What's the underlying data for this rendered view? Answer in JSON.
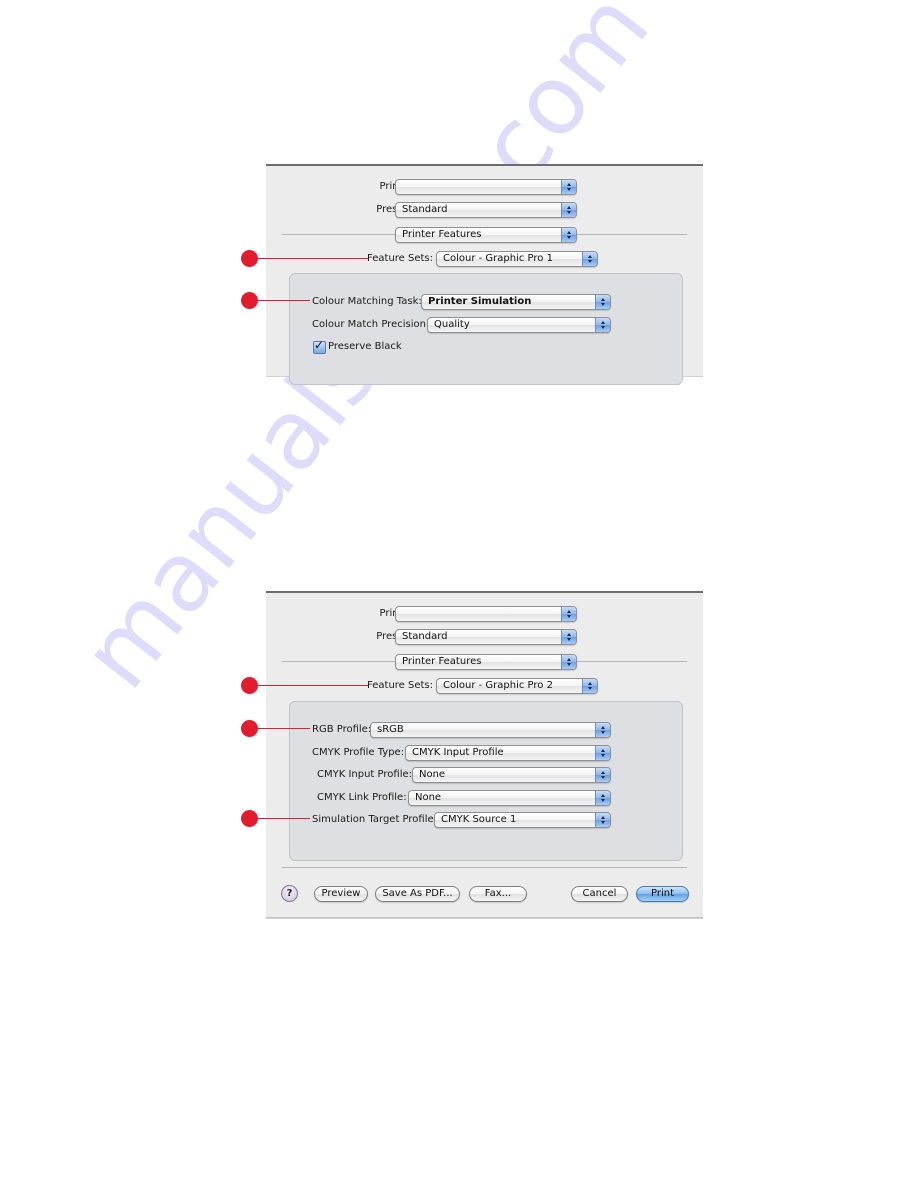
{
  "dialog1": {
    "printer": {
      "label": "Printer:",
      "value": ""
    },
    "presets": {
      "label": "Presets:",
      "value": "Standard"
    },
    "pane": {
      "value": "Printer Features"
    },
    "feature_sets": {
      "label": "Feature Sets:",
      "value": "Colour - Graphic Pro 1"
    },
    "colour_matching_task": {
      "label": "Colour Matching Task:",
      "value": "Printer Simulation"
    },
    "colour_match_precision": {
      "label": "Colour Match Precision:",
      "value": "Quality"
    },
    "preserve_black": {
      "label": "Preserve Black",
      "checked": true
    }
  },
  "dialog2": {
    "printer": {
      "label": "Printer:",
      "value": ""
    },
    "presets": {
      "label": "Presets:",
      "value": "Standard"
    },
    "pane": {
      "value": "Printer Features"
    },
    "feature_sets": {
      "label": "Feature Sets:",
      "value": "Colour - Graphic Pro 2"
    },
    "rgb_profile": {
      "label": "RGB Profile:",
      "value": "sRGB"
    },
    "cmyk_profile_type": {
      "label": "CMYK Profile Type:",
      "value": "CMYK Input Profile"
    },
    "cmyk_input_profile": {
      "label": "CMYK Input Profile:",
      "value": "None"
    },
    "cmyk_link_profile": {
      "label": "CMYK Link Profile:",
      "value": "None"
    },
    "simulation_target_profile": {
      "label": "Simulation Target Profile:",
      "value": "CMYK Source 1"
    },
    "buttons": {
      "help": "?",
      "preview": "Preview",
      "save_as_pdf": "Save As PDF...",
      "fax": "Fax...",
      "cancel": "Cancel",
      "print": "Print"
    }
  },
  "callout_color": "#e31b2d",
  "watermark": "manualshive.com"
}
